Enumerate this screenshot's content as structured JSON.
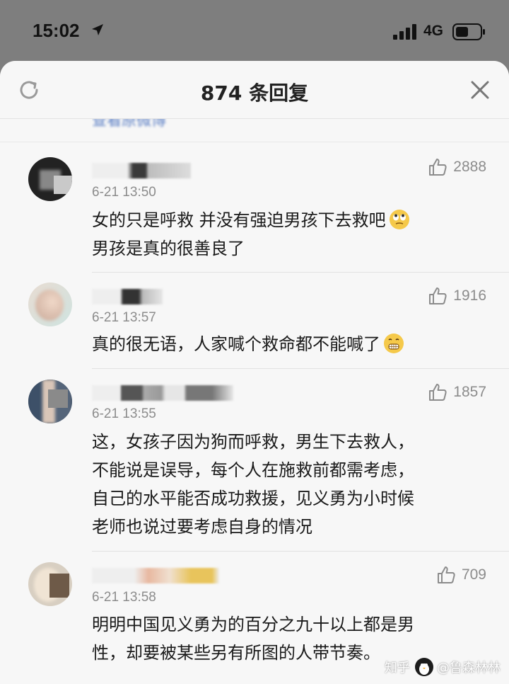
{
  "status": {
    "time": "15:02",
    "network": "4G"
  },
  "sheet": {
    "title": "874 条回复",
    "origin_link": "查看原微博"
  },
  "comments": [
    {
      "time": "6-21 13:50",
      "likes": "2888",
      "text_lines": [
        "女的只是呼救 并没有强迫男孩下去救吧",
        "男孩是真的很善良了"
      ],
      "emoji": "eye-roll"
    },
    {
      "time": "6-21 13:57",
      "likes": "1916",
      "text_lines": [
        "真的很无语，人家喊个救命都不能喊了"
      ],
      "emoji": "grimace"
    },
    {
      "time": "6-21 13:55",
      "likes": "1857",
      "text_lines": [
        "这，女孩子因为狗而呼救，男生下去救人，",
        "不能说是误导，每个人在施救前都需考虑，",
        "自己的水平能否成功救援，见义勇为小时候",
        "老师也说过要考虑自身的情况"
      ]
    },
    {
      "time": "6-21 13:58",
      "likes": "709",
      "text_lines": [
        "明明中国见义勇为的百分之九十以上都是男",
        "性，却要被某些另有所图的人带节奏。"
      ]
    }
  ],
  "watermark": {
    "site": "知乎",
    "author": "@鲁森林林"
  },
  "colors": {
    "overlay": "#7e7e7e",
    "sheet_bg": "#f7f7f7",
    "link": "#5a7ec4",
    "meta_text": "#8c8c8c"
  }
}
